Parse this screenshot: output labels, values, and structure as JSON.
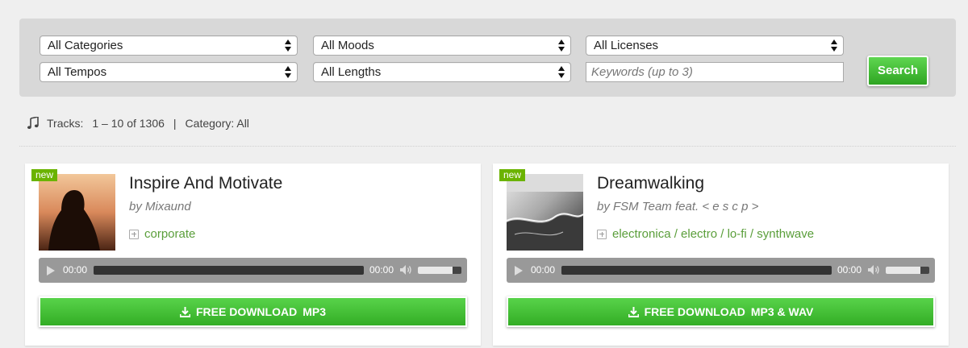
{
  "filters": {
    "categories": "All Categories",
    "moods": "All Moods",
    "licenses": "All Licenses",
    "tempos": "All Tempos",
    "lengths": "All Lengths",
    "keywords_placeholder": "Keywords (up to 3)",
    "search_label": "Search"
  },
  "tracks_info": {
    "label": "Tracks:",
    "range": "1 – 10 of 1306",
    "separator": "|",
    "category": "Category: All"
  },
  "tracks": [
    {
      "badge": "new",
      "title": "Inspire And Motivate",
      "artist": "by Mixaund",
      "tags": "corporate",
      "time_current": "00:00",
      "time_total": "00:00",
      "volume_level": 0.8,
      "download_label": "FREE DOWNLOAD",
      "download_format": "MP3"
    },
    {
      "badge": "new",
      "title": "Dreamwalking",
      "artist": "by FSM Team feat. < e s c p >",
      "tags": "electronica / electro / lo-fi / synthwave",
      "time_current": "00:00",
      "time_total": "00:00",
      "volume_level": 0.8,
      "download_label": "FREE DOWNLOAD",
      "download_format": "MP3 & WAV"
    }
  ]
}
